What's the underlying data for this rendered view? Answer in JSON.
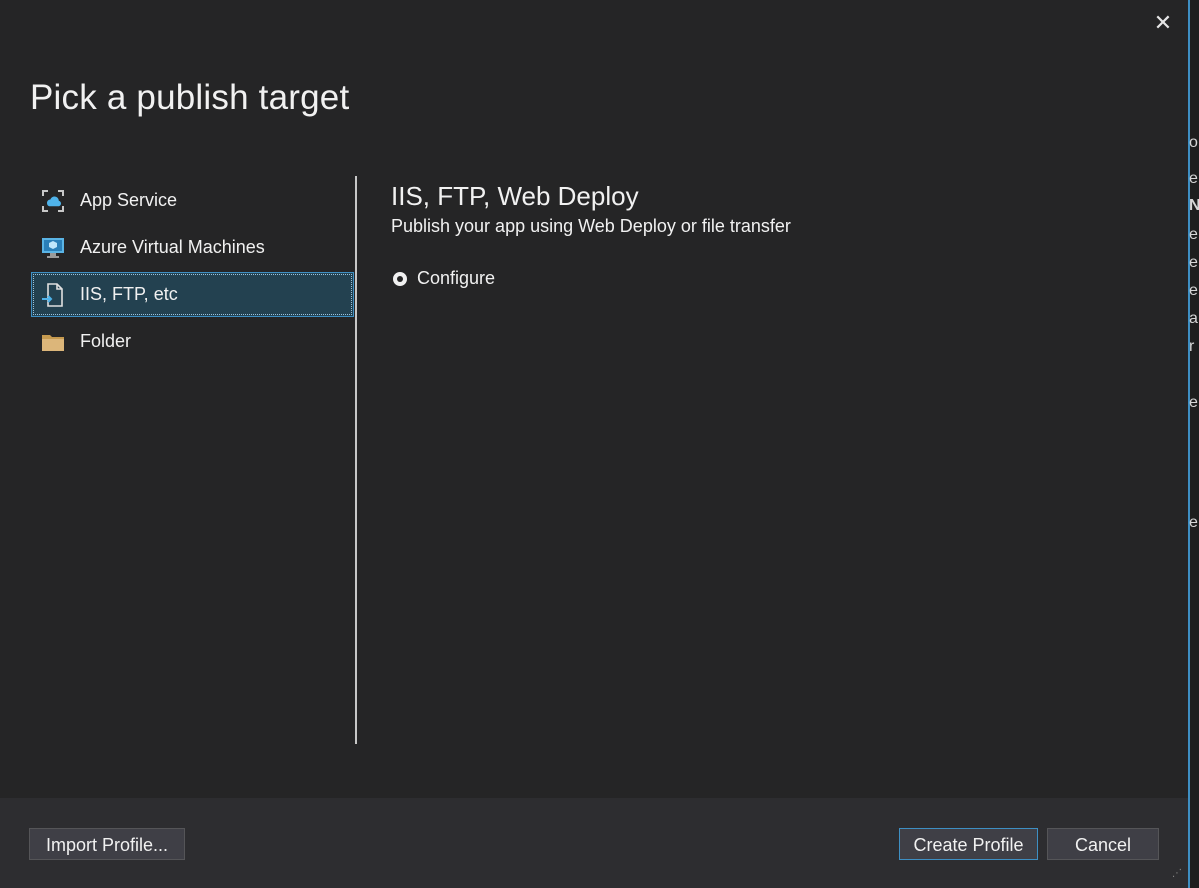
{
  "dialog": {
    "title": "Pick a publish target",
    "close_glyph": "✕"
  },
  "targets": [
    {
      "label": "App Service",
      "icon": "app-service-icon",
      "selected": false
    },
    {
      "label": "Azure Virtual Machines",
      "icon": "virtual-machine-icon",
      "selected": false
    },
    {
      "label": "IIS, FTP, etc",
      "icon": "publish-file-icon",
      "selected": true
    },
    {
      "label": "Folder",
      "icon": "folder-icon",
      "selected": false
    }
  ],
  "detail": {
    "title": "IIS, FTP, Web Deploy",
    "description": "Publish your app using Web Deploy or file transfer",
    "options": [
      {
        "label": "Configure",
        "selected": true
      }
    ]
  },
  "footer": {
    "import_label": "Import Profile...",
    "create_label": "Create Profile",
    "cancel_label": "Cancel"
  },
  "colors": {
    "background": "#252526",
    "footer": "#2d2d30",
    "accent": "#3e8fc3",
    "selected_bg": "#234150"
  },
  "edge_fragments": [
    "o",
    "e",
    "N",
    "e",
    "e",
    "e",
    "a",
    "r",
    "e",
    "e"
  ]
}
